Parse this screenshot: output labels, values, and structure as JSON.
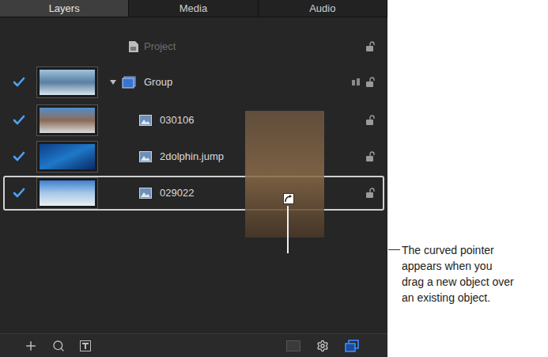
{
  "tabs": [
    {
      "label": "Layers",
      "selected": true
    },
    {
      "label": "Media",
      "selected": false
    },
    {
      "label": "Audio",
      "selected": false
    }
  ],
  "project": {
    "label": "Project",
    "locked": false
  },
  "layers": [
    {
      "name": "Group",
      "kind": "group",
      "checked": true,
      "expanded": true,
      "locked": false,
      "drop_target": false
    },
    {
      "name": "030106",
      "kind": "image",
      "checked": true,
      "locked": false,
      "drop_target": false
    },
    {
      "name": "2dolphin.jump",
      "kind": "image",
      "checked": true,
      "locked": false,
      "drop_target": false
    },
    {
      "name": "029022",
      "kind": "image",
      "checked": true,
      "locked": false,
      "drop_target": true
    }
  ],
  "callout": {
    "lines": [
      "The curved pointer",
      "appears when you",
      "drag a new object over",
      "an existing object."
    ]
  }
}
